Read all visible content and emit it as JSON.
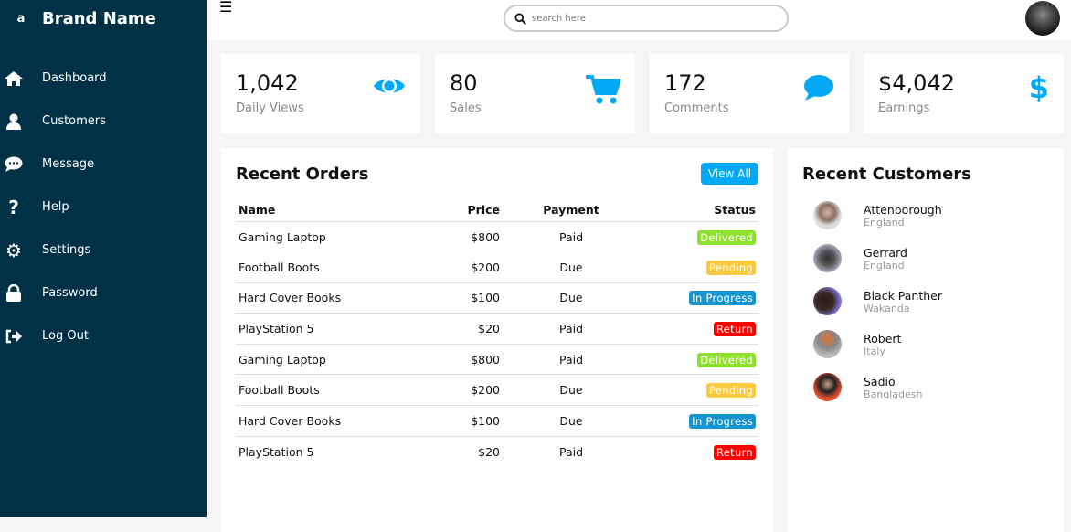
{
  "brand": {
    "logo": "a",
    "name": "Brand Name"
  },
  "nav": [
    {
      "label": "Dashboard",
      "icon": "home-icon"
    },
    {
      "label": "Customers",
      "icon": "user-icon"
    },
    {
      "label": "Message",
      "icon": "comment-icon"
    },
    {
      "label": "Help",
      "icon": "question-icon"
    },
    {
      "label": "Settings",
      "icon": "gear-icon"
    },
    {
      "label": "Password",
      "icon": "lock-icon"
    },
    {
      "label": "Log Out",
      "icon": "sign-out-icon"
    }
  ],
  "search": {
    "placeholder": "search here"
  },
  "cards": [
    {
      "value": "1,042",
      "label": "Daily Views",
      "icon": "eye-icon"
    },
    {
      "value": "80",
      "label": "Sales",
      "icon": "cart-icon"
    },
    {
      "value": "172",
      "label": "Comments",
      "icon": "comment-icon"
    },
    {
      "value": "$4,042",
      "label": "Earnings",
      "icon": "dollar-icon"
    }
  ],
  "orders": {
    "title": "Recent Orders",
    "view_all": "View All",
    "headers": [
      "Name",
      "Price",
      "Payment",
      "Status"
    ],
    "rows": [
      {
        "name": "Gaming Laptop",
        "price": "$800",
        "payment": "Paid",
        "status": "Delivered"
      },
      {
        "name": "Football Boots",
        "price": "$200",
        "payment": "Due",
        "status": "Pending"
      },
      {
        "name": "Hard Cover Books",
        "price": "$100",
        "payment": "Due",
        "status": "In Progress"
      },
      {
        "name": "PlayStation 5",
        "price": "$20",
        "payment": "Paid",
        "status": "Return"
      },
      {
        "name": "Gaming Laptop",
        "price": "$800",
        "payment": "Paid",
        "status": "Delivered"
      },
      {
        "name": "Football Boots",
        "price": "$200",
        "payment": "Due",
        "status": "Pending"
      },
      {
        "name": "Hard Cover Books",
        "price": "$100",
        "payment": "Due",
        "status": "In Progress"
      },
      {
        "name": "PlayStation 5",
        "price": "$20",
        "payment": "Paid",
        "status": "Return"
      }
    ]
  },
  "status_colors": {
    "Delivered": "#8de02c",
    "Pending": "#f9ca3f",
    "In Progress": "#1795ce",
    "Return": "#ff0000"
  },
  "customers": {
    "title": "Recent Customers",
    "items": [
      {
        "name": "Attenborough",
        "country": "England"
      },
      {
        "name": "Gerrard",
        "country": "England"
      },
      {
        "name": "Black Panther",
        "country": "Wakanda"
      },
      {
        "name": "Robert",
        "country": "Italy"
      },
      {
        "name": "Sadio",
        "country": "Bangladesh"
      }
    ]
  },
  "accent": "#03a9f4"
}
